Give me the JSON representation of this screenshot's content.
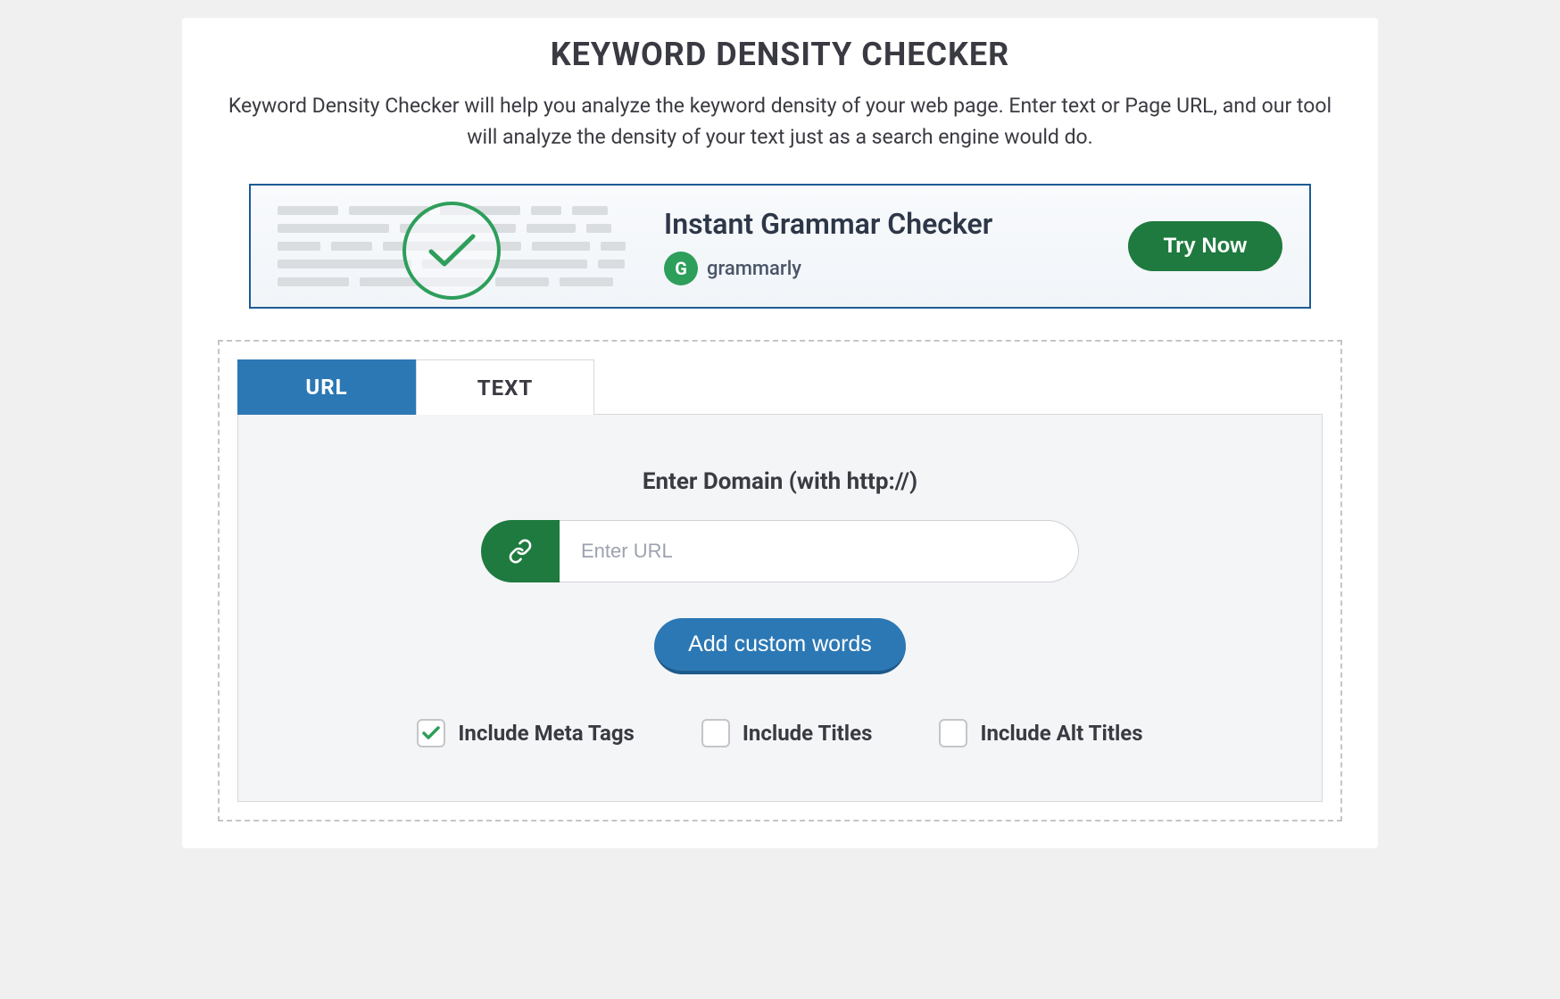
{
  "header": {
    "title": "KEYWORD DENSITY CHECKER",
    "description": "Keyword Density Checker will help you analyze the keyword density of your web page. Enter text or Page URL, and our tool will analyze the density of your text just as a search engine would do."
  },
  "ad": {
    "headline": "Instant Grammar Checker",
    "brand": "grammarly",
    "cta": "Try Now"
  },
  "tabs": {
    "url": "URL",
    "text": "TEXT"
  },
  "form": {
    "domain_label": "Enter Domain (with http://)",
    "url_placeholder": "Enter URL",
    "custom_words_button": "Add custom words"
  },
  "checkboxes": {
    "meta": {
      "label": "Include Meta Tags",
      "checked": true
    },
    "titles": {
      "label": "Include Titles",
      "checked": false
    },
    "alt": {
      "label": "Include Alt Titles",
      "checked": false
    }
  }
}
